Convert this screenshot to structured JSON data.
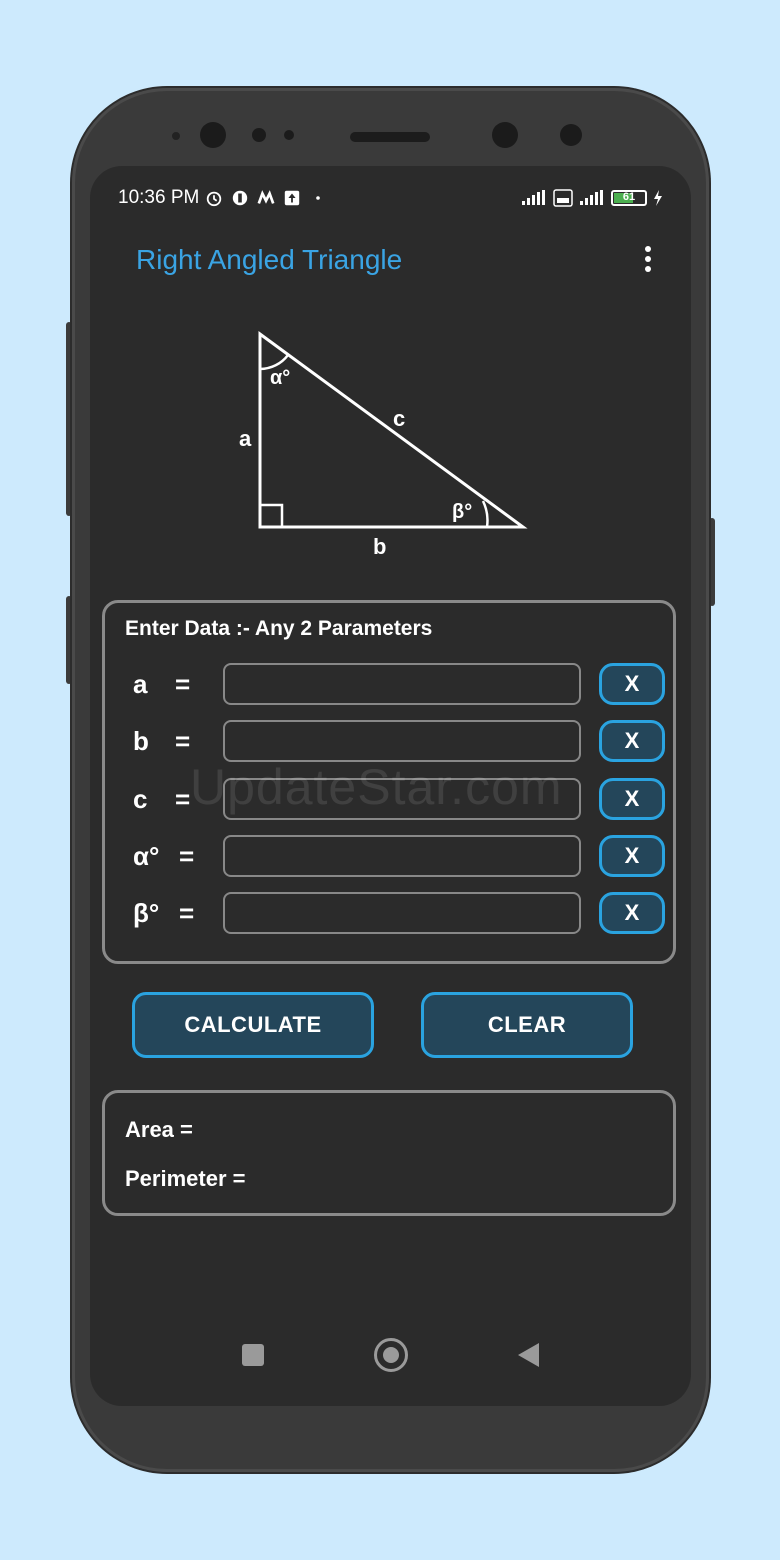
{
  "status_bar": {
    "time": "10:36 PM",
    "battery": "61"
  },
  "app": {
    "title": "Right Angled Triangle"
  },
  "diagram": {
    "labels": {
      "alpha": "α°",
      "beta": "β°",
      "a": "a",
      "b": "b",
      "c": "c"
    }
  },
  "input_panel": {
    "title": "Enter Data :-  Any 2 Parameters",
    "rows": [
      {
        "label": "a",
        "eq": "=",
        "value": "",
        "clear": "X"
      },
      {
        "label": "b",
        "eq": "=",
        "value": "",
        "clear": "X"
      },
      {
        "label": "c",
        "eq": "=",
        "value": "",
        "clear": "X"
      },
      {
        "label": "α°",
        "eq": "=",
        "value": "",
        "clear": "X"
      },
      {
        "label": "β°",
        "eq": "=",
        "value": "",
        "clear": "X"
      }
    ]
  },
  "actions": {
    "calculate": "CALCULATE",
    "clear": "CLEAR"
  },
  "results": {
    "area": "Area =",
    "perimeter": "Perimeter ="
  },
  "watermark": "UpdateStar.com"
}
